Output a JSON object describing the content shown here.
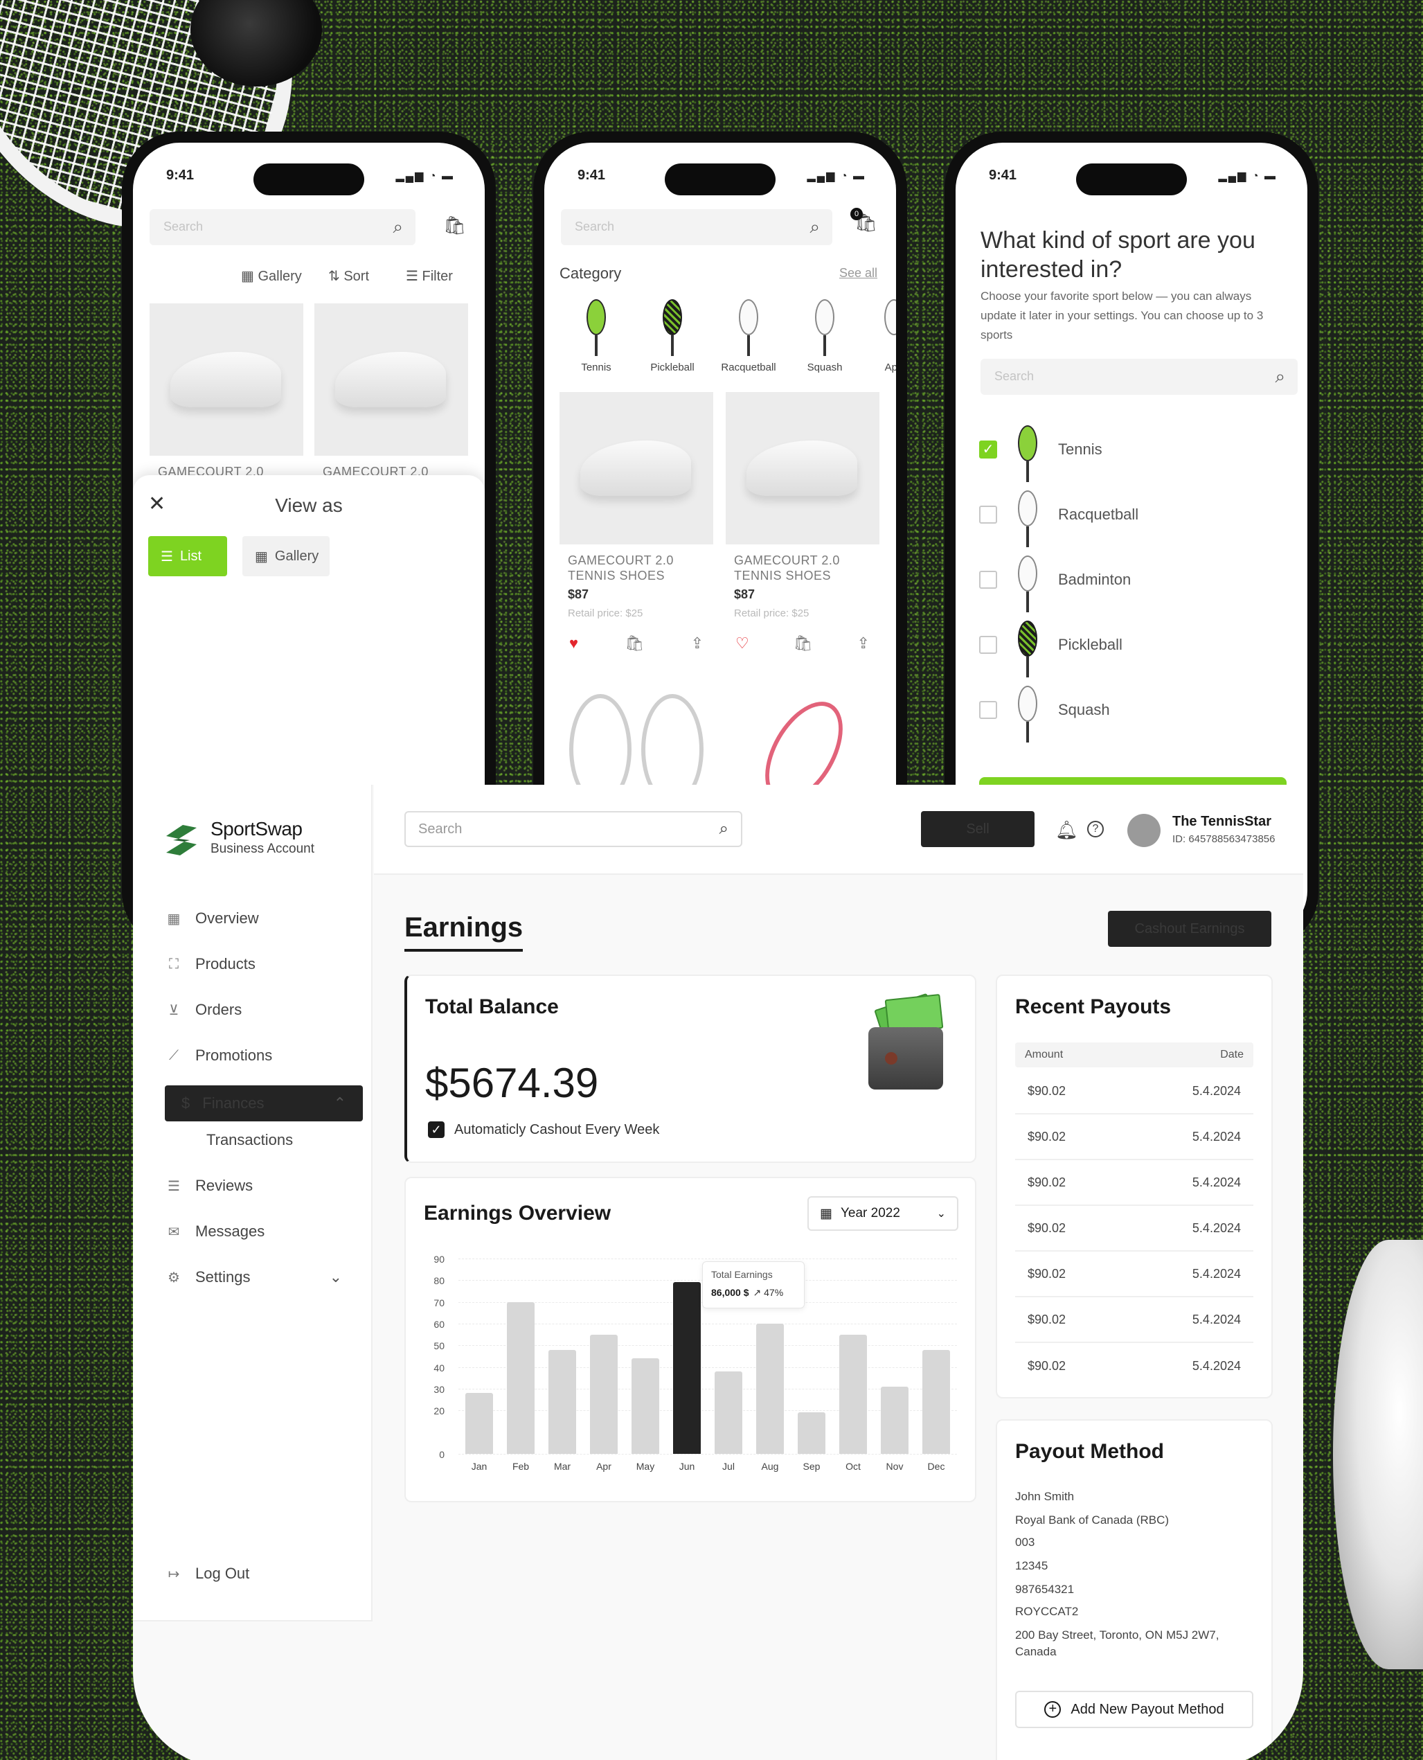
{
  "phones": {
    "time": "9:41",
    "status_icons": "▂▄▆ ◔ ▬",
    "phone1": {
      "search_placeholder": "Search",
      "toolbar": {
        "gallery": "Gallery",
        "sort": "Sort",
        "filter": "Filter"
      },
      "products": [
        {
          "name": "GAMECOURT 2.0"
        },
        {
          "name": "GAMECOURT 2.0"
        }
      ],
      "sheet": {
        "title": "View as",
        "list": "List",
        "gallery": "Gallery"
      }
    },
    "phone2": {
      "search_placeholder": "Search",
      "cart_badge": "0",
      "category_title": "Category",
      "see_all": "See all",
      "categories": [
        "Tennis",
        "Pickleball",
        "Racquetball",
        "Squash",
        "App"
      ],
      "products": [
        {
          "name": "GAMECOURT 2.0 TENNIS SHOES",
          "price": "$87",
          "retail": "Retail price: $25"
        },
        {
          "name": "GAMECOURT 2.0 TENNIS SHOES",
          "price": "$87",
          "retail": "Retail price: $25"
        }
      ]
    },
    "phone3": {
      "title": "What kind of sport are you interested in?",
      "subtitle": "Choose your favorite sport below — you can always update it later in your settings. You can choose up to 3 sports",
      "search_placeholder": "Search",
      "sports": [
        {
          "label": "Tennis",
          "checked": true
        },
        {
          "label": "Racquetball",
          "checked": false
        },
        {
          "label": "Badminton",
          "checked": false
        },
        {
          "label": "Pickleball",
          "checked": false
        },
        {
          "label": "Squash",
          "checked": false
        }
      ]
    }
  },
  "dashboard": {
    "brand": {
      "name": "SportSwap",
      "sub": "Business Account"
    },
    "nav": {
      "overview": "Overview",
      "products": "Products",
      "orders": "Orders",
      "promotions": "Promotions",
      "finances": "Finances",
      "transactions": "Transactions",
      "reviews": "Reviews",
      "messages": "Messages",
      "settings": "Settings",
      "logout": "Log Out"
    },
    "topbar": {
      "search_placeholder": "Search",
      "sell": "Sell",
      "user_name": "The TennisStar",
      "user_id": "ID: 645788563473856"
    },
    "page_title": "Earnings",
    "cashout_button": "Cashout Earnings",
    "balance": {
      "title": "Total Balance",
      "amount": "$5674.39",
      "auto_cashout": "Automaticly Cashout Every Week"
    },
    "overview": {
      "title": "Earnings Overview",
      "year": "Year 2022",
      "tooltip_title": "Total Earnings",
      "tooltip_value": "86,000 $",
      "tooltip_change": "↗ 47%"
    },
    "payouts": {
      "title": "Recent Payouts",
      "col_amount": "Amount",
      "col_date": "Date",
      "rows": [
        {
          "amount": "$90.02",
          "date": "5.4.2024"
        },
        {
          "amount": "$90.02",
          "date": "5.4.2024"
        },
        {
          "amount": "$90.02",
          "date": "5.4.2024"
        },
        {
          "amount": "$90.02",
          "date": "5.4.2024"
        },
        {
          "amount": "$90.02",
          "date": "5.4.2024"
        },
        {
          "amount": "$90.02",
          "date": "5.4.2024"
        },
        {
          "amount": "$90.02",
          "date": "5.4.2024"
        }
      ]
    },
    "payout_method": {
      "title": "Payout Method",
      "name": "John Smith",
      "bank": "Royal Bank of Canada (RBC)",
      "institution": "003",
      "transit": "12345",
      "account": "987654321",
      "swift": "ROYCCAT2",
      "address": "200 Bay Street, Toronto, ON M5J 2W7, Canada",
      "add_button": "Add New Payout Method"
    }
  },
  "chart_data": {
    "type": "bar",
    "categories": [
      "Jan",
      "Feb",
      "Mar",
      "Apr",
      "May",
      "Jun",
      "Jul",
      "Aug",
      "Sep",
      "Oct",
      "Nov",
      "Dec"
    ],
    "values": [
      28,
      70,
      48,
      55,
      44,
      79,
      38,
      60,
      19,
      55,
      31,
      48
    ],
    "highlight": "Jun",
    "ylim": [
      0,
      90
    ],
    "yticks": [
      0,
      20,
      30,
      40,
      50,
      60,
      70,
      80,
      90
    ],
    "grid": true,
    "colors": {
      "bar": "#d7d7d7",
      "active": "#242424"
    }
  }
}
